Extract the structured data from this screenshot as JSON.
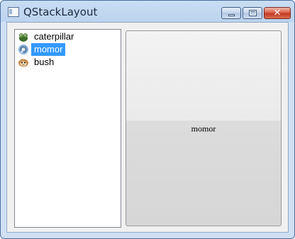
{
  "window": {
    "title": "QStackLayout",
    "close_glyph": "✕"
  },
  "list": {
    "items": [
      {
        "label": "caterpillar",
        "icon": "caterpillar-icon"
      },
      {
        "label": "momor",
        "icon": "momor-icon",
        "selected": true
      },
      {
        "label": "bush",
        "icon": "bush-icon"
      }
    ]
  },
  "panel": {
    "label": "momor"
  },
  "colors": {
    "selection": "#3399ff",
    "title_bar": "#c9ddf3"
  }
}
